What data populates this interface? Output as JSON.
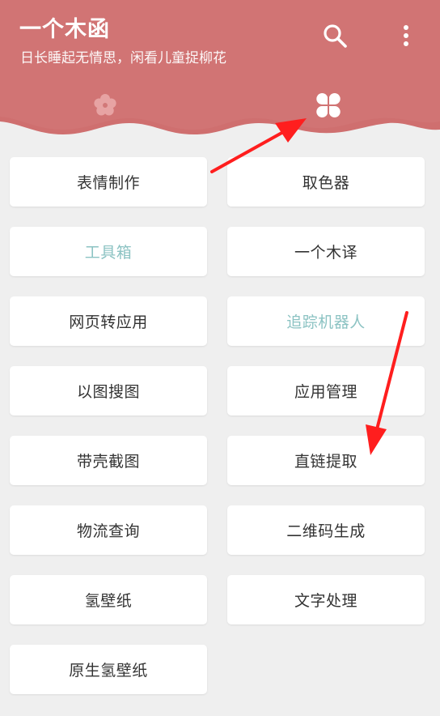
{
  "app": {
    "title": "一个木函",
    "subtitle": "日长睡起无情思，闲看儿童捉柳花",
    "header_color": "#d07272"
  },
  "toolbar": {
    "search_icon": "search-icon",
    "more_icon": "more-vertical-icon"
  },
  "tabs": [
    {
      "icon": "flower-icon",
      "active": false
    },
    {
      "icon": "grid-icon",
      "active": true
    }
  ],
  "tools": [
    {
      "label": "表情制作",
      "enabled": true
    },
    {
      "label": "取色器",
      "enabled": true
    },
    {
      "label": "工具箱",
      "enabled": false
    },
    {
      "label": "一个木译",
      "enabled": true
    },
    {
      "label": "网页转应用",
      "enabled": true
    },
    {
      "label": "追踪机器人",
      "enabled": false
    },
    {
      "label": "以图搜图",
      "enabled": true
    },
    {
      "label": "应用管理",
      "enabled": true
    },
    {
      "label": "带壳截图",
      "enabled": true
    },
    {
      "label": "直链提取",
      "enabled": true
    },
    {
      "label": "物流查询",
      "enabled": true
    },
    {
      "label": "二维码生成",
      "enabled": true
    },
    {
      "label": "氢壁纸",
      "enabled": true
    },
    {
      "label": "文字处理",
      "enabled": true
    },
    {
      "label": "原生氢壁纸",
      "enabled": true
    }
  ],
  "colors": {
    "annotation_arrow": "#ff1e1e",
    "disabled_text": "#8cc3c3"
  }
}
